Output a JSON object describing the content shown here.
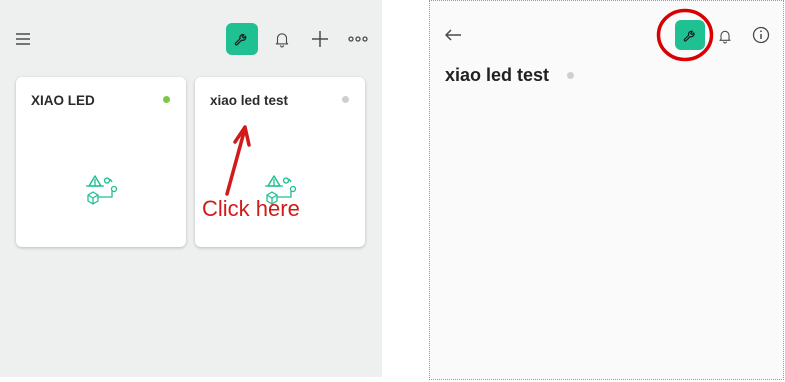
{
  "left_panel": {
    "toolbar": {
      "menu_icon": "hamburger-menu-icon",
      "wrench_icon": "wrench-icon",
      "bell_icon": "bell-icon",
      "add_icon": "plus-icon",
      "more_icon": "more-dots-icon"
    },
    "devices": [
      {
        "name": "XIAO LED",
        "status": "online",
        "status_color": "#7ac943",
        "icon": "device-blueprint-icon"
      },
      {
        "name": "xiao led test",
        "status": "offline",
        "status_color": "#cfcfcf",
        "icon": "device-blueprint-icon"
      }
    ]
  },
  "annotation": {
    "text": "Click here",
    "color": "#d11a1a"
  },
  "right_panel": {
    "back_icon": "arrow-left-icon",
    "device_title": "xiao led test",
    "status_color": "#cfcfcf",
    "toolbar": {
      "wrench_icon": "wrench-icon",
      "bell_icon": "bell-icon",
      "info_icon": "info-icon"
    }
  },
  "accent_color": "#1fc092",
  "highlight_color": "#d80000"
}
